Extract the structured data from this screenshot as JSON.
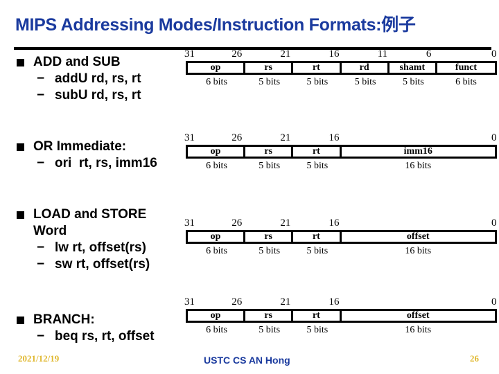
{
  "slide": {
    "title": "MIPS Addressing Modes/Instruction Formats:例子",
    "footer": {
      "date": "2021/12/19",
      "author": "USTC CS AN Hong",
      "page": "26"
    }
  },
  "bullets": [
    {
      "heading": "ADD and SUB",
      "items": [
        "addU rd, rs, rt",
        "subU rd, rs, rt"
      ]
    },
    {
      "heading": "OR Immediate:",
      "items": [
        "ori  rt, rs, imm16"
      ]
    },
    {
      "heading": "LOAD and STORE",
      "heading2": "Word",
      "items": [
        "lw rt, offset(rs)",
        "sw rt, offset(rs)"
      ]
    },
    {
      "heading": "BRANCH:",
      "items": [
        "beq rs, rt, offset"
      ]
    }
  ],
  "formats": [
    {
      "bits": [
        "31",
        "26",
        "21",
        "16",
        "11",
        "6",
        "0"
      ],
      "fields": [
        {
          "name": "op",
          "width": "6 bits"
        },
        {
          "name": "rs",
          "width": "5 bits"
        },
        {
          "name": "rt",
          "width": "5 bits"
        },
        {
          "name": "rd",
          "width": "5 bits"
        },
        {
          "name": "shamt",
          "width": "5 bits"
        },
        {
          "name": "funct",
          "width": "6 bits"
        }
      ]
    },
    {
      "bits": [
        "31",
        "26",
        "21",
        "16",
        "0"
      ],
      "fields": [
        {
          "name": "op",
          "width": "6 bits"
        },
        {
          "name": "rs",
          "width": "5 bits"
        },
        {
          "name": "rt",
          "width": "5 bits"
        },
        {
          "name": "imm16",
          "width": "16 bits"
        }
      ]
    },
    {
      "bits": [
        "31",
        "26",
        "21",
        "16",
        "0"
      ],
      "fields": [
        {
          "name": "op",
          "width": "6 bits"
        },
        {
          "name": "rs",
          "width": "5 bits"
        },
        {
          "name": "rt",
          "width": "5 bits"
        },
        {
          "name": "offset",
          "width": "16 bits"
        }
      ]
    },
    {
      "bits": [
        "31",
        "26",
        "21",
        "16",
        "0"
      ],
      "fields": [
        {
          "name": "op",
          "width": "6 bits"
        },
        {
          "name": "rs",
          "width": "5 bits"
        },
        {
          "name": "rt",
          "width": "5 bits"
        },
        {
          "name": "offset",
          "width": "16 bits"
        }
      ]
    }
  ],
  "colors": {
    "title": "#1a3a9e",
    "footer_accent": "#e0b830"
  }
}
